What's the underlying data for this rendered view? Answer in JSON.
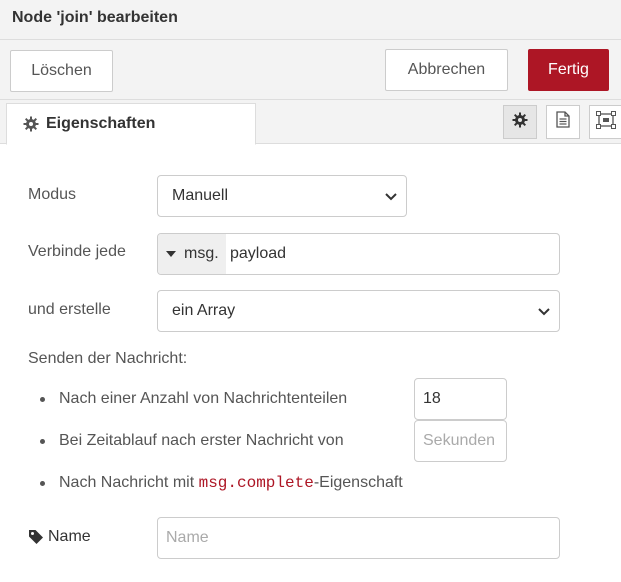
{
  "tray": {
    "title": "Node 'join' bearbeiten"
  },
  "toolbar": {
    "delete_label": "Löschen",
    "cancel_label": "Abbrechen",
    "done_label": "Fertig"
  },
  "tabs": {
    "properties_label": "Eigenschaften"
  },
  "form": {
    "mode": {
      "label": "Modus",
      "value": "Manuell"
    },
    "combine": {
      "label": "Verbinde jede",
      "type": "msg.",
      "value": "payload"
    },
    "create": {
      "label": "und erstelle",
      "value": "ein Array"
    },
    "send": {
      "label": "Senden der Nachricht:",
      "count_label": "Nach einer Anzahl von Nachrichtenteilen",
      "count_value": "18",
      "timeout_label": "Bei Zeitablauf nach erster Nachricht von",
      "timeout_placeholder": "Sekunden",
      "complete_prefix": "Nach Nachricht mit ",
      "complete_code": "msg.complete",
      "complete_suffix": "-Eigenschaft"
    },
    "name": {
      "label": "Name",
      "placeholder": "Name"
    }
  },
  "colors": {
    "accent": "#ad1625",
    "header_bg": "#f3f3f3"
  }
}
